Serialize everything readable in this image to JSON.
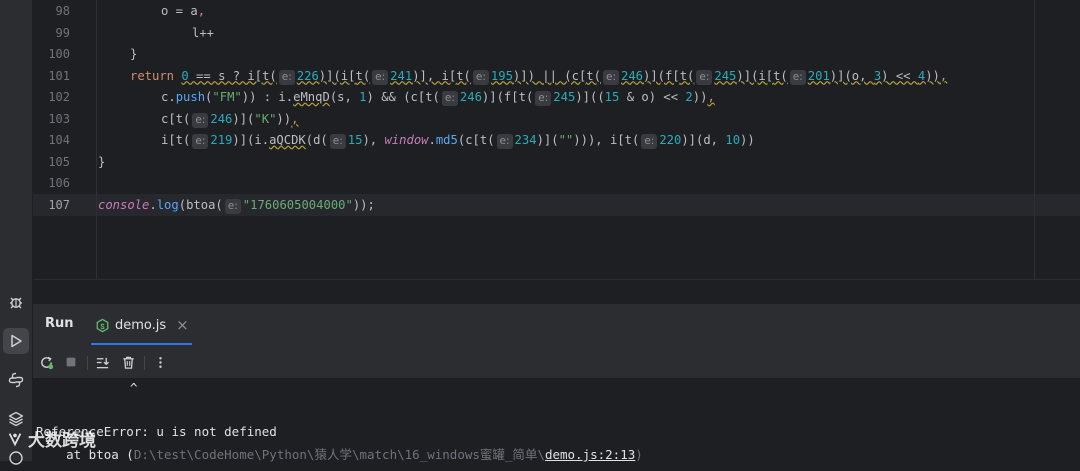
{
  "editor": {
    "lines": [
      {
        "num": "98"
      },
      {
        "num": "99"
      },
      {
        "num": "100"
      },
      {
        "num": "101"
      },
      {
        "num": "102"
      },
      {
        "num": "103"
      },
      {
        "num": "104"
      },
      {
        "num": "105"
      },
      {
        "num": "106"
      },
      {
        "num": "107"
      }
    ],
    "hint_label": "e:"
  },
  "tool_strip": {
    "icons": [
      "debug-icon",
      "run-icon",
      "python-console-icon",
      "layers-icon"
    ]
  },
  "run_panel": {
    "title": "Run",
    "tab_label": "demo.js",
    "close_glyph": "×",
    "toolbar": {
      "rerun": "rerun-icon",
      "stop": "stop-icon",
      "scroll_to_end": "scroll-to-end-icon",
      "clear": "trash-icon",
      "more": "more-vertical-icon"
    }
  },
  "console": {
    "caret": "^",
    "error_line": "ReferenceError: u is not defined",
    "stack_prefix": "    at btoa (",
    "stack_path": "D:\\test\\CodeHome\\Python\\猿人学\\match\\16_windows蜜罐_简单\\",
    "stack_file": "demo.js:2:13",
    "stack_suffix": ")"
  },
  "watermark": {
    "text": "大数跨境"
  },
  "colors": {
    "background": "#1e1f22",
    "panel": "#2b2d30",
    "keyword": "#cf8e6d",
    "number": "#2aacb8",
    "string": "#6aab73",
    "accent": "#3574f0"
  }
}
